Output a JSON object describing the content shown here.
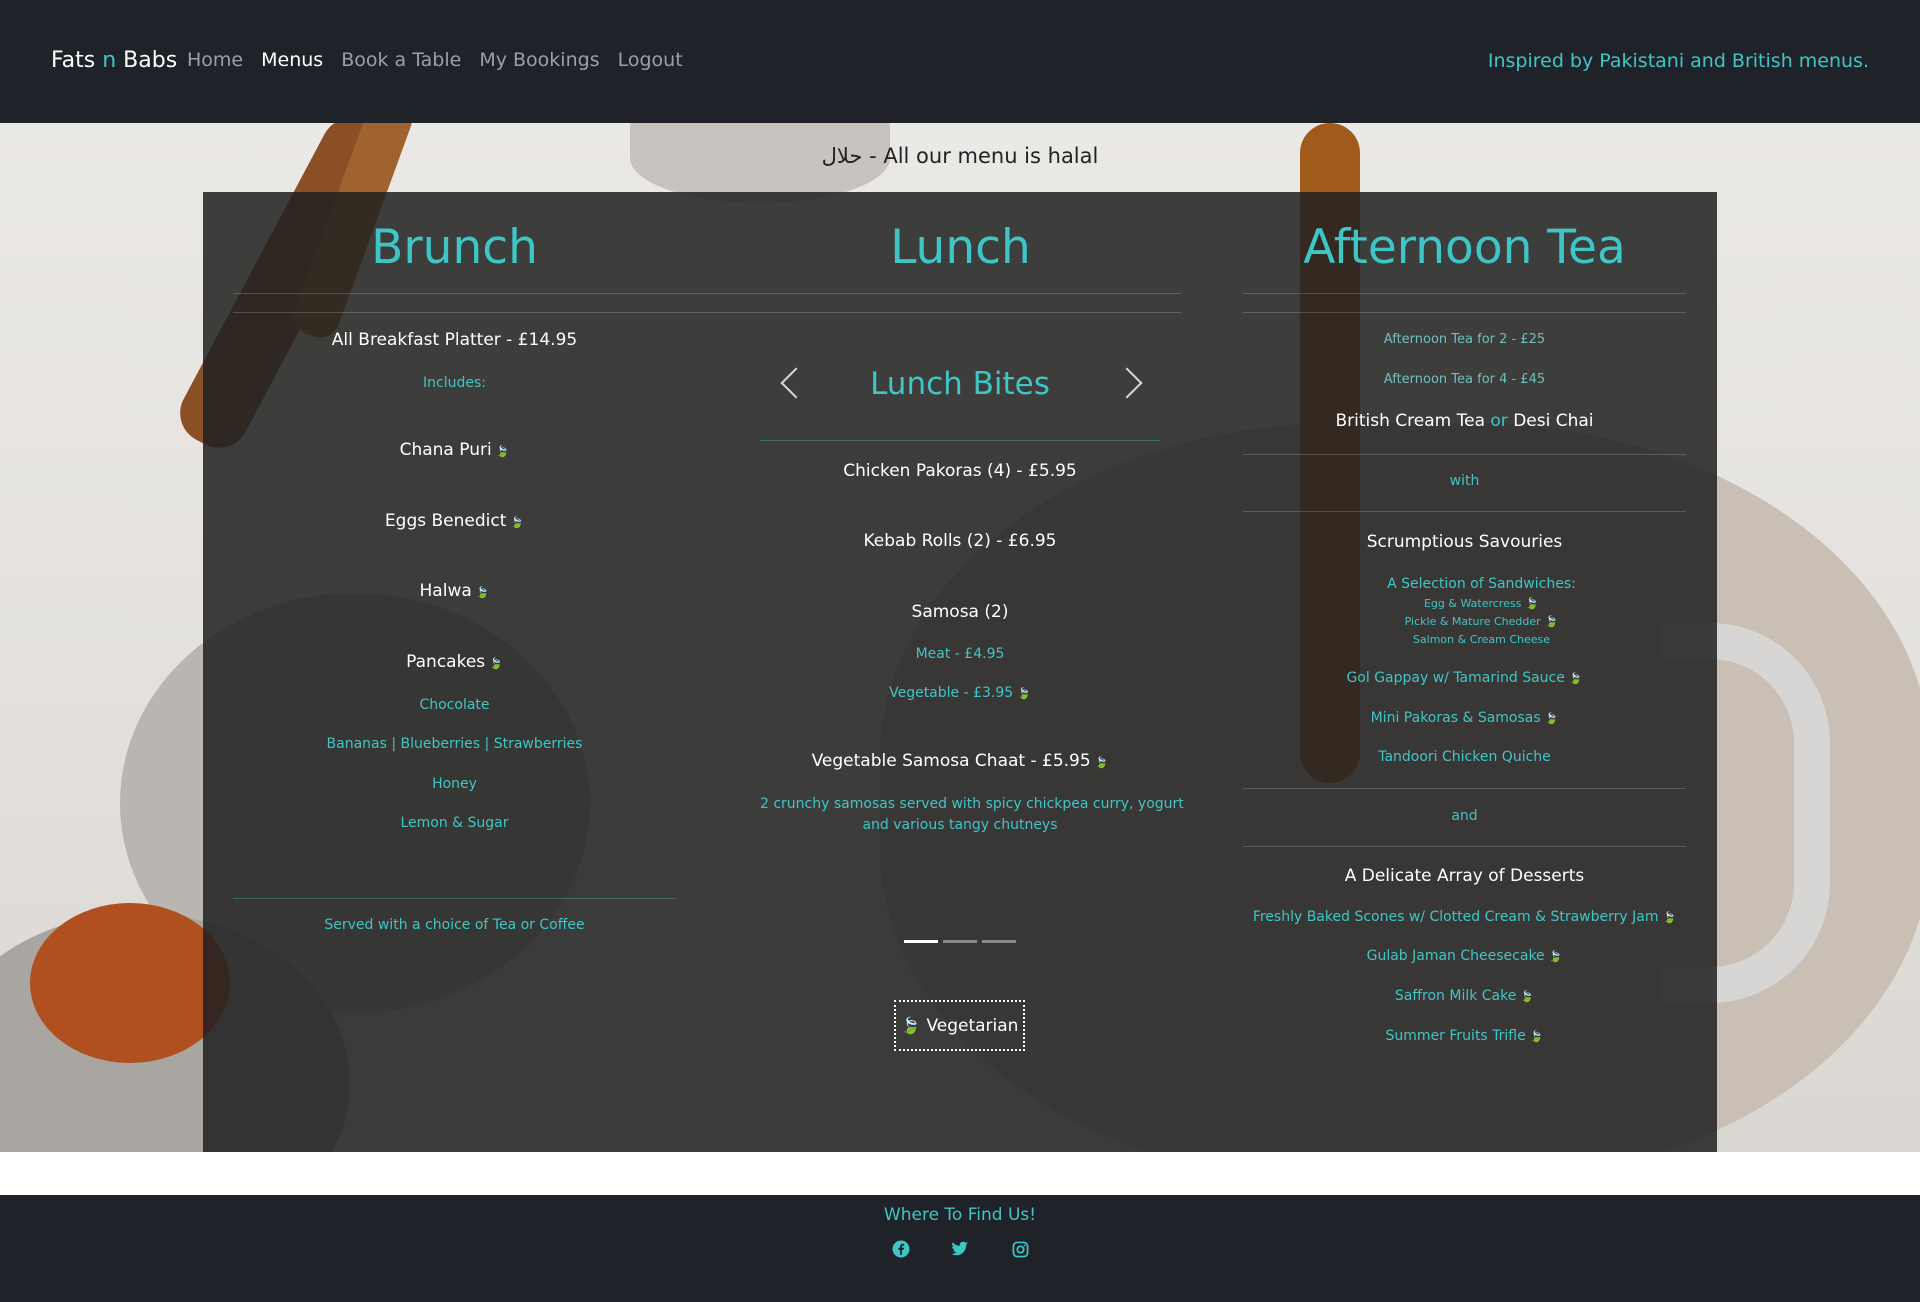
{
  "navbar": {
    "brand_pre": "Fats ",
    "brand_accent": "n",
    "brand_post": " Babs",
    "links": [
      "Home",
      "Menus",
      "Book a Table",
      "My Bookings",
      "Logout"
    ],
    "active": "Menus",
    "tagline": "Inspired by Pakistani and British menus."
  },
  "halal": {
    "arabic": "حلال",
    "text": " - All our menu is halal"
  },
  "brunch": {
    "title": "Brunch",
    "platter": "All Breakfast Platter - £14.95",
    "includes": "Includes:",
    "items": [
      "Chana Puri",
      "Eggs Benedict",
      "Halwa",
      "Pancakes"
    ],
    "pancake_options": [
      "Chocolate",
      "Bananas | Blueberries | Strawberries",
      "Honey",
      "Lemon & Sugar"
    ],
    "served": "Served with a choice of Tea or Coffee"
  },
  "lunch": {
    "title": "Lunch",
    "carousel_title": "Lunch Bites",
    "items": {
      "pakoras": "Chicken Pakoras (4) - £5.95",
      "kebab": "Kebab Rolls (2) - £6.95",
      "samosa": "Samosa (2)",
      "samosa_meat": "Meat - £4.95",
      "samosa_veg": "Vegetable - £3.95",
      "chaat": "Vegetable Samosa Chaat - £5.95",
      "chaat_desc_1": "2 crunchy samosas served with spicy chickpea curry, yogurt",
      "chaat_desc_2": "and various tangy chutneys"
    },
    "slides": 3,
    "active_slide": 0,
    "veg_label": "Vegetarian"
  },
  "afternoon_tea": {
    "title": "Afternoon Tea",
    "price_2": "Afternoon Tea for 2 - £25",
    "price_4": "Afternoon Tea for 4 - £45",
    "tea_a": "British Cream Tea",
    "tea_or": " or ",
    "tea_b": "Desi Chai",
    "with": "with",
    "savouries_title": "Scrumptious Savouries",
    "sandwiches_title": "A Selection of Sandwiches:",
    "sandwiches": [
      "Egg & Watercress",
      "Pickle & Mature Chedder",
      "Salmon & Cream Cheese"
    ],
    "savouries": [
      "Gol Gappay w/ Tamarind Sauce",
      "Mini Pakoras & Samosas",
      "Tandoori Chicken Quiche"
    ],
    "and": "and",
    "desserts_title": "A Delicate Array of Desserts",
    "desserts": [
      "Freshly Baked Scones w/ Clotted Cream & Strawberry Jam",
      "Gulab Jaman Cheesecake",
      "Saffron Milk Cake",
      "Summer Fruits Trifle"
    ]
  },
  "footer": {
    "title": "Where To Find Us!",
    "social": [
      "facebook-icon",
      "twitter-icon",
      "instagram-icon"
    ]
  },
  "colors": {
    "accent": "#3ec6c6",
    "veg_leaf": "#3fbf5f",
    "nav_bg": "#1f2329"
  }
}
